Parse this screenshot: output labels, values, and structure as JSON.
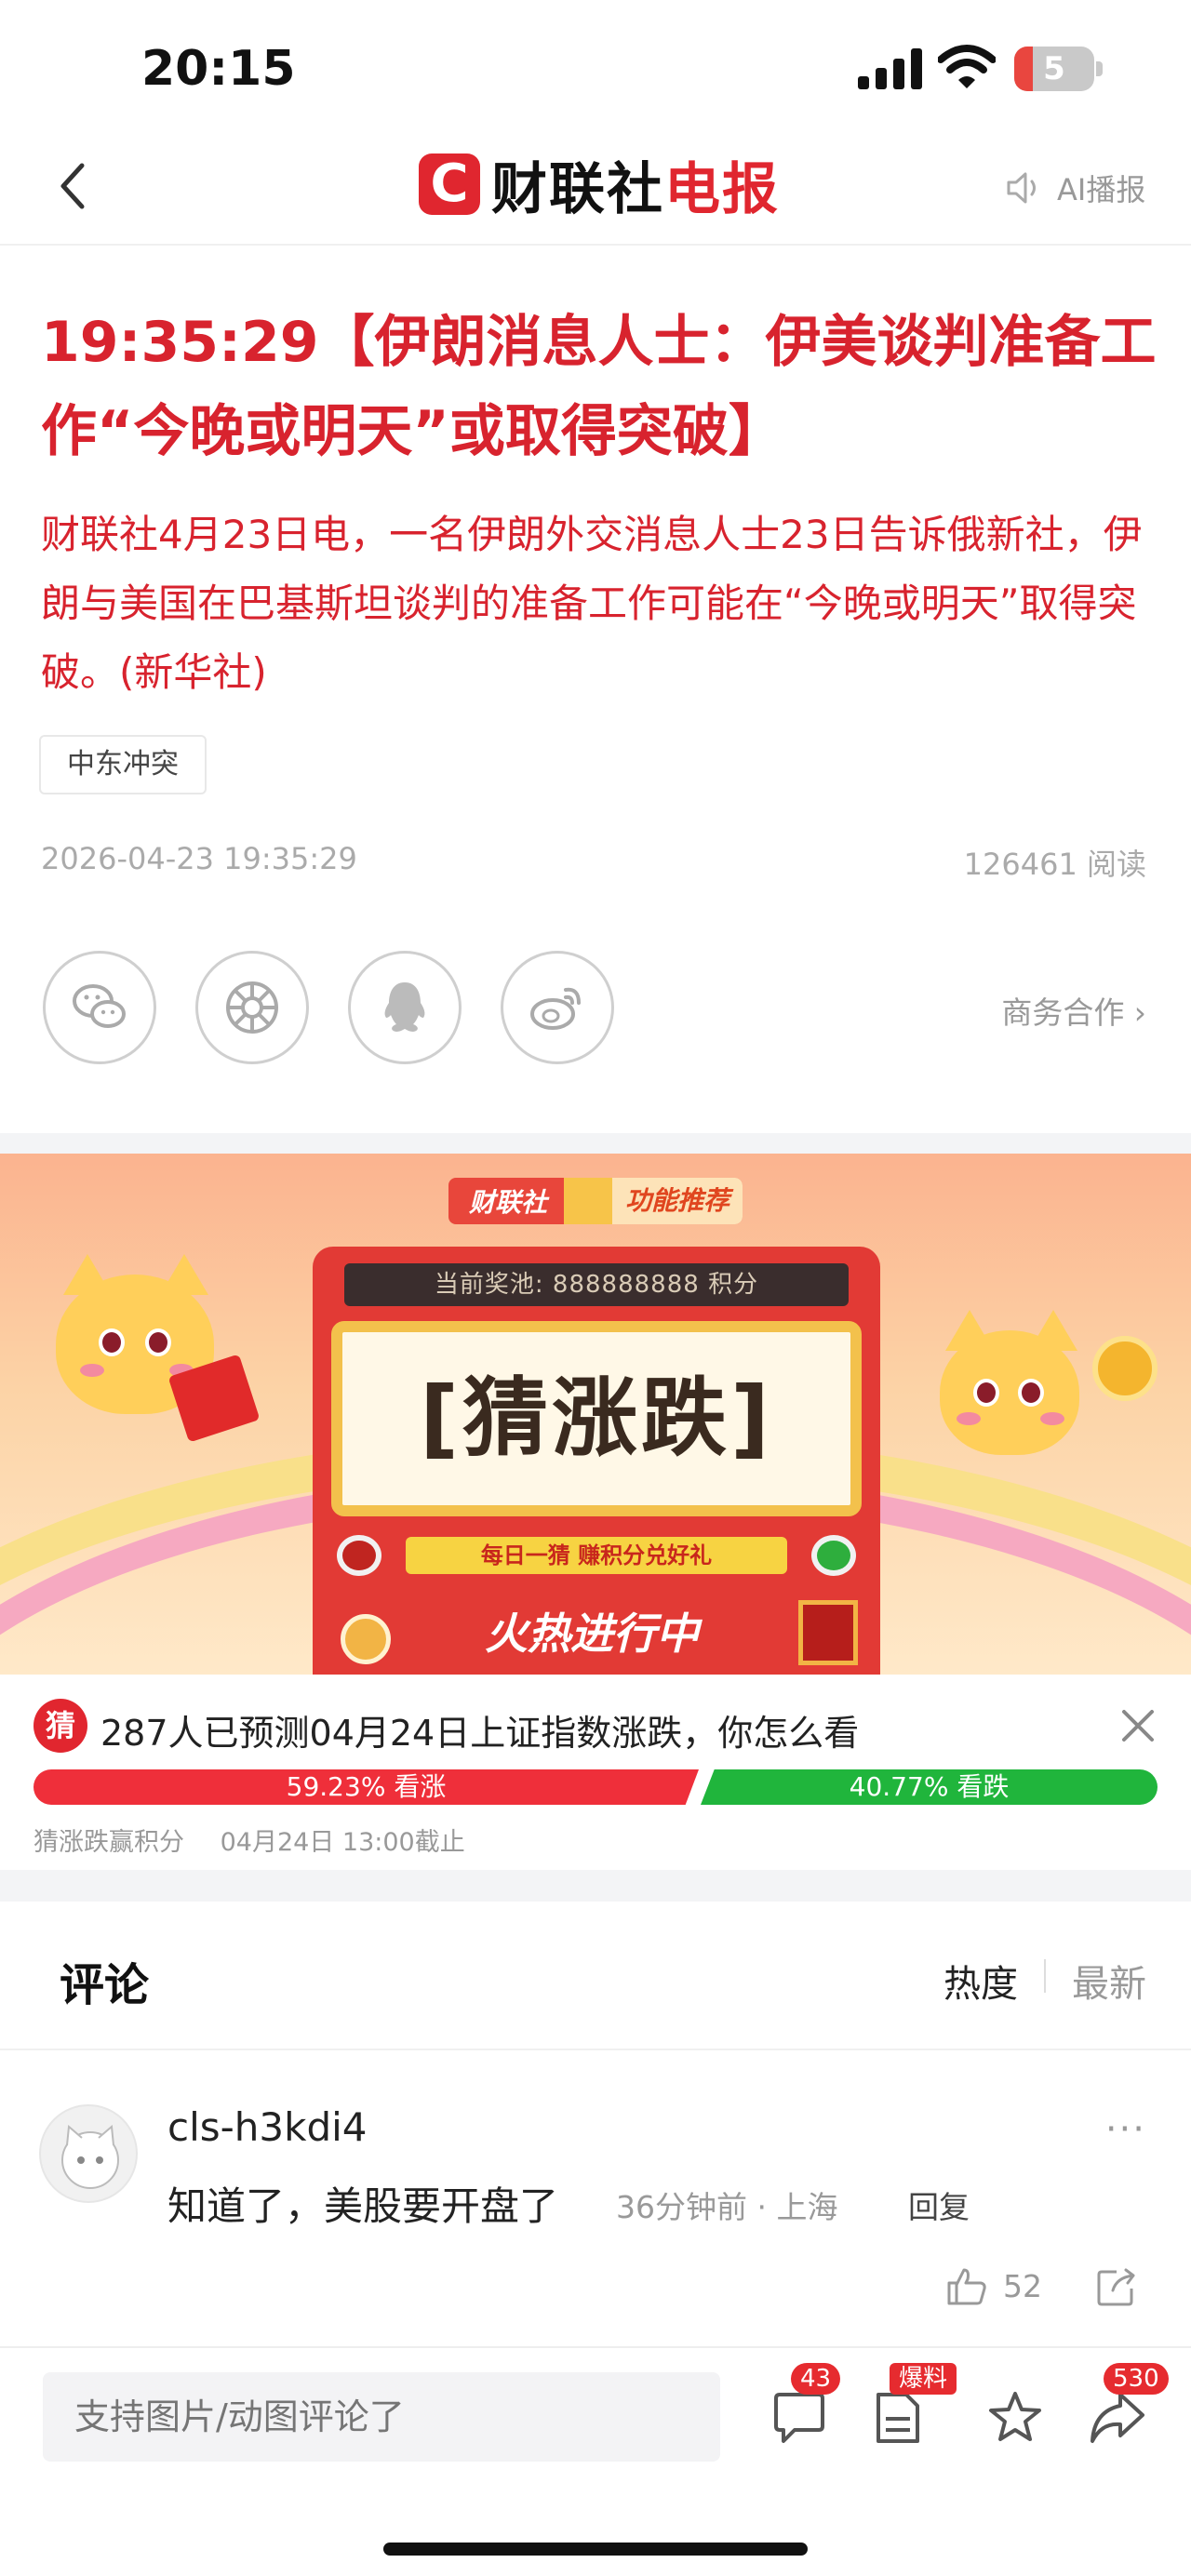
{
  "status_bar": {
    "time": "20:15",
    "battery": "5"
  },
  "nav": {
    "brand_logo": "C",
    "brand_name": "财联社",
    "brand_suffix": "电报",
    "ai_label": "AI播报"
  },
  "article": {
    "title": "19:35:29【伊朗消息人士：伊美谈判准备工作“今晚或明天”或取得突破】",
    "body": "财联社4月23日电，一名伊朗外交消息人士23日告诉俄新社，伊朗与美国在巴基斯坦谈判的准备工作可能在“今晚或明天”取得突破。(新华社)",
    "tag": "中东冲突",
    "date": "2026-04-23 19:35:29",
    "reads": "126461 阅读",
    "share_icons": [
      "wechat-icon",
      "moments-icon",
      "qq-icon",
      "weibo-icon"
    ],
    "business_link": "商务合作 ›"
  },
  "banner": {
    "chip_left": "财联社",
    "chip_right": "功能推荐",
    "pool": "当前奖池: 888888888 积分",
    "game_title": "[猜涨跌]",
    "daily": "每日一猜 赚积分兑好礼",
    "hot": "火热进行中"
  },
  "guess": {
    "icon": "猜",
    "question": "287人已预测04月24日上证指数涨跌，你怎么看",
    "up_pct": 59.23,
    "up_label": "59.23% 看涨",
    "down_label": "40.77% 看跌",
    "footer_left": "猜涨跌赢积分",
    "footer_right": "04月24日 13:00截止"
  },
  "comments": {
    "title": "评论",
    "sort_hot": "热度",
    "sort_new": "最新",
    "items": [
      {
        "user": "cls-h3kdi4",
        "text": "知道了，美股要开盘了",
        "meta": "36分钟前 · 上海",
        "reply": "回复",
        "likes": "52",
        "more": "···"
      }
    ]
  },
  "bottom_bar": {
    "input_placeholder": "支持图片/动图评论了",
    "comment_count": "43",
    "tip_label": "爆料",
    "share_count": "530"
  },
  "colors": {
    "accent": "#d8232e",
    "up": "#ef2f3a",
    "down": "#20b53c"
  }
}
